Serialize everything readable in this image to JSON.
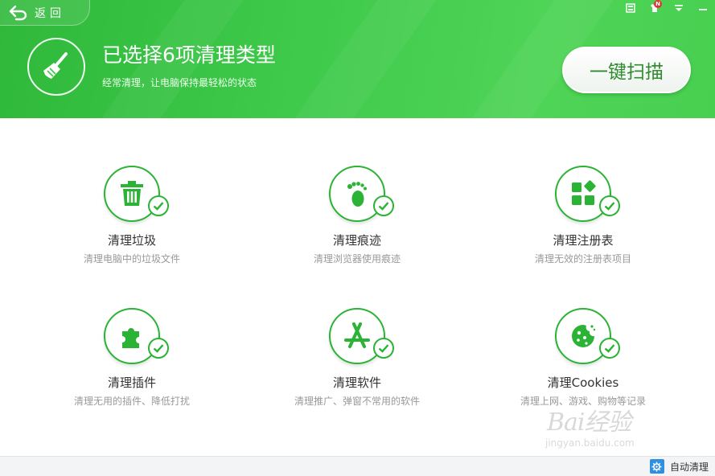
{
  "header": {
    "back_label": "返回",
    "title": "已选择6项清理类型",
    "subtitle": "经常清理，让电脑保持最轻松的状态",
    "scan_button": "一键扫描",
    "notification_badge": "N",
    "icons": [
      "back-arrow-icon",
      "skin-icon",
      "tshirt-icon",
      "menu-icon",
      "minimize-icon",
      "broom-icon"
    ]
  },
  "items": [
    {
      "title": "清理垃圾",
      "desc": "清理电脑中的垃圾文件",
      "icon": "trash-icon",
      "checked": true
    },
    {
      "title": "清理痕迹",
      "desc": "清理浏览器使用痕迹",
      "icon": "footprint-icon",
      "checked": true
    },
    {
      "title": "清理注册表",
      "desc": "清理无效的注册表项目",
      "icon": "registry-blocks-icon",
      "checked": true
    },
    {
      "title": "清理插件",
      "desc": "清理无用的插件、降低打扰",
      "icon": "puzzle-icon",
      "checked": true
    },
    {
      "title": "清理软件",
      "desc": "清理推广、弹窗不常用的软件",
      "icon": "app-store-icon",
      "checked": true
    },
    {
      "title": "清理Cookies",
      "desc": "清理上网、游戏、购物等记录",
      "icon": "cookie-icon",
      "checked": true
    }
  ],
  "footer": {
    "auto_clean_label": "自动清理",
    "icon": "gear-icon"
  },
  "watermark": {
    "brand": "Bai经验",
    "url": "jingyan.baidu.com"
  },
  "colors": {
    "primary_green": "#2ab334",
    "header_green": "#3ec94a",
    "scan_text": "#2e8b2e",
    "footer_bg": "#f3f4f5",
    "gear_blue": "#2f8fe3"
  }
}
